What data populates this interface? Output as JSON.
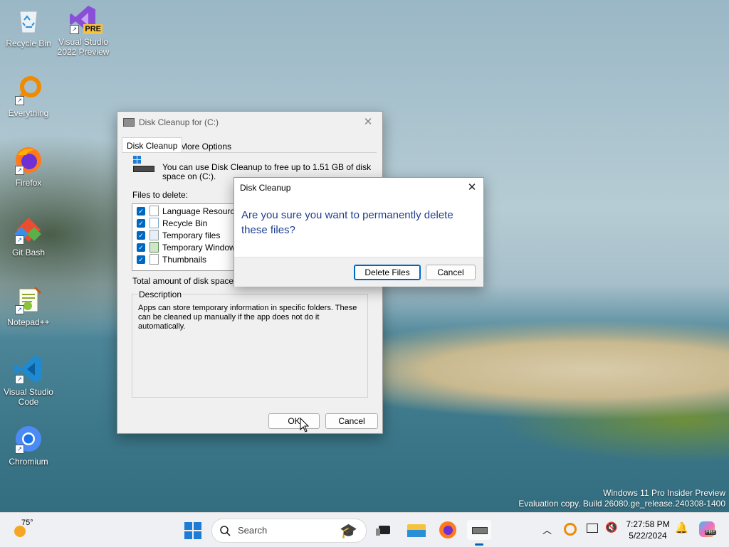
{
  "desktop_icons": [
    {
      "label": "Recycle Bin",
      "icon": "recycle-bin-icon"
    },
    {
      "label": "Visual Studio 2022 Preview",
      "line1": "Visual Studio",
      "line2": "2022 Preview",
      "badge": "PRE",
      "icon": "visual-studio-icon"
    },
    {
      "label": "Everything",
      "icon": "everything-search-icon"
    },
    {
      "label": "Firefox",
      "icon": "firefox-icon"
    },
    {
      "label": "Git Bash",
      "icon": "git-bash-icon"
    },
    {
      "label": "Notepad++",
      "icon": "notepadpp-icon"
    },
    {
      "label": "Visual Studio Code",
      "line1": "Visual Studio",
      "line2": "Code",
      "icon": "vscode-icon"
    },
    {
      "label": "Chromium",
      "icon": "chromium-icon"
    }
  ],
  "main_dialog": {
    "title": "Disk Cleanup for  (C:)",
    "tabs": [
      "Disk Cleanup",
      "More Options"
    ],
    "intro_line1": "You can use Disk Cleanup to free up to 1.51 GB of disk",
    "intro_line2": "space on  (C:).",
    "files_label": "Files to delete:",
    "files": [
      {
        "name": "Language Resource F",
        "checked": true
      },
      {
        "name": "Recycle Bin",
        "checked": true
      },
      {
        "name": "Temporary files",
        "checked": true
      },
      {
        "name": "Temporary Windows in",
        "checked": true
      },
      {
        "name": "Thumbnails",
        "checked": true
      }
    ],
    "total_label": "Total amount of disk space you",
    "description_title": "Description",
    "description_line1": "Apps can store temporary information in specific folders. These",
    "description_line2": "can be cleaned up manually if the app does not do it",
    "description_line3": "automatically.",
    "ok_label": "OK",
    "cancel_label": "Cancel"
  },
  "confirm_dialog": {
    "title": "Disk Cleanup",
    "question_line1": "Are you sure you want to permanently delete",
    "question_line2": "these files?",
    "delete_label": "Delete Files",
    "cancel_label": "Cancel"
  },
  "watermark": {
    "line1": "Windows 11 Pro Insider Preview",
    "line2": "Evaluation copy. Build 26080.ge_release.240308-1400"
  },
  "taskbar": {
    "weather_temp": "75°",
    "search_placeholder": "Search",
    "time": "7:27:58 PM",
    "date": "5/22/2024",
    "copilot_badge": "PRE"
  },
  "colors": {
    "accent": "#0067c0",
    "question_text": "#1f3f91"
  }
}
